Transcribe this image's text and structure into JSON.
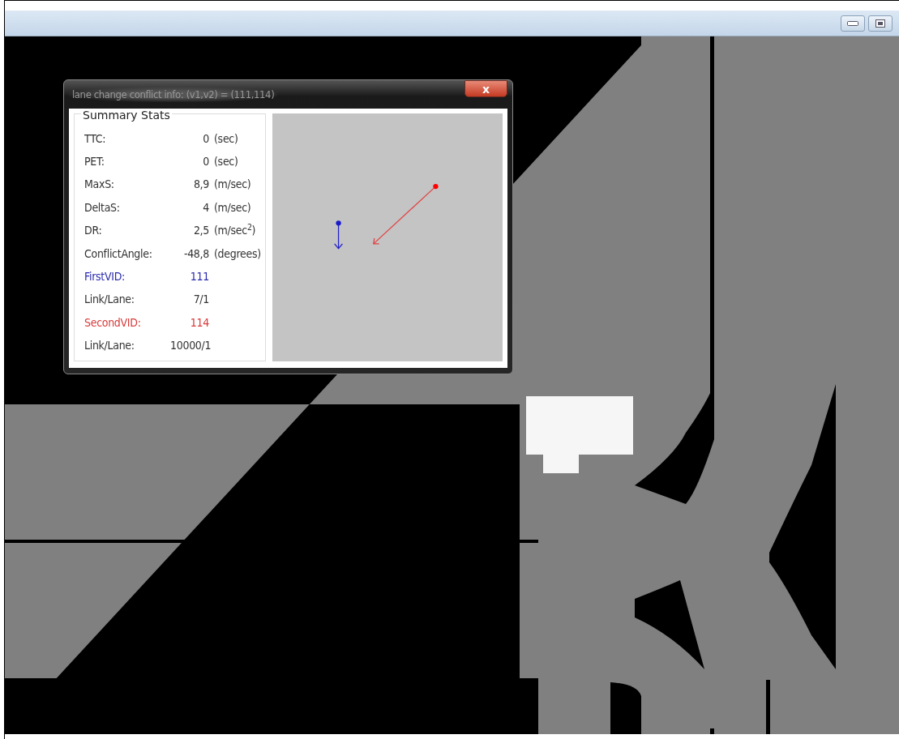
{
  "dialog": {
    "title": "lane change conflict info: (v1,v2) = (111,114)",
    "close_label": "x"
  },
  "summary": {
    "legend": "Summary Stats",
    "rows": [
      {
        "label": "TTC:",
        "value": "0",
        "unit": "(sec)",
        "color": "#333333"
      },
      {
        "label": "PET:",
        "value": "0",
        "unit": "(sec)",
        "color": "#333333"
      },
      {
        "label": "MaxS:",
        "value": "8,9",
        "unit": "(m/sec)",
        "color": "#333333"
      },
      {
        "label": "DeltaS:",
        "value": "4",
        "unit": "(m/sec)",
        "color": "#333333"
      },
      {
        "label": "DR:",
        "value": "2,5",
        "unit": "(m/sec$^{2}$)",
        "color": "#333333"
      },
      {
        "label": "ConflictAngle:",
        "value": "-48,8",
        "unit": "(degrees)",
        "color": "#333333"
      },
      {
        "label": "FirstVID:",
        "value": "111",
        "color": "#2b2bb0"
      },
      {
        "label": "Link/Lane:",
        "value": "7/1",
        "color": "#333333"
      },
      {
        "label": "SecondVID:",
        "value": "114",
        "color": "#d83a3a"
      },
      {
        "label": "Link/Lane:",
        "value": "10000/1",
        "color": "#333333"
      }
    ]
  }
}
